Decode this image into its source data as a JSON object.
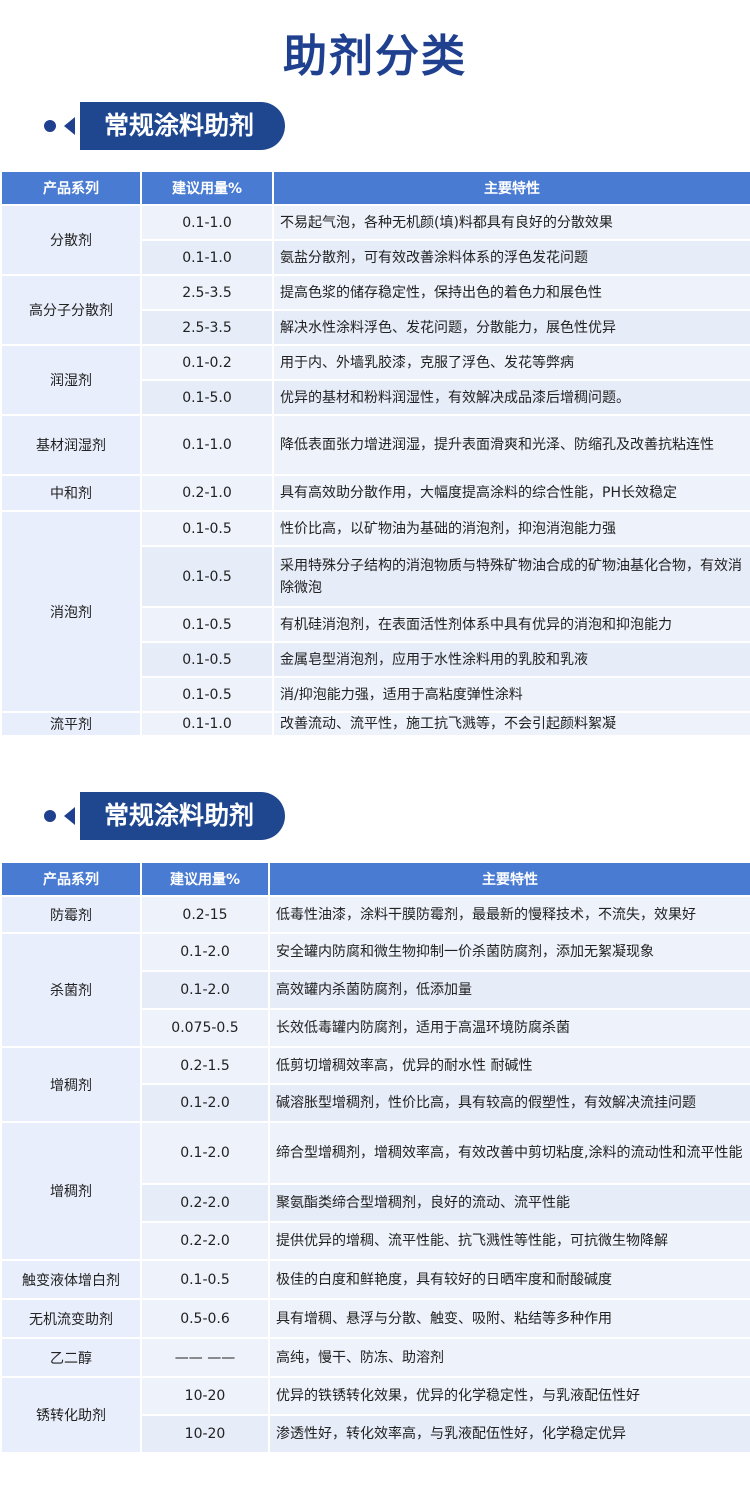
{
  "title": "助剂分类",
  "sections": [
    {
      "heading": "常规涂料助剂",
      "columns": [
        "产品系列",
        "建议用量%",
        "主要特性"
      ],
      "groups": [
        {
          "series": "分散剂",
          "rows": [
            {
              "dose": "0.1-1.0",
              "feature": "不易起气泡，各种无机颜(填)料都具有良好的分散效果"
            },
            {
              "dose": "0.1-1.0",
              "feature": "氨盐分散剂，可有效改善涂料体系的浮色发花问题"
            }
          ]
        },
        {
          "series": "高分子分散剂",
          "rows": [
            {
              "dose": "2.5-3.5",
              "feature": "提高色浆的储存稳定性，保持出色的着色力和展色性"
            },
            {
              "dose": "2.5-3.5",
              "feature": "解决水性涂料浮色、发花问题，分散能力，展色性优异"
            }
          ]
        },
        {
          "series": "润湿剂",
          "rows": [
            {
              "dose": "0.1-0.2",
              "feature": "用于内、外墙乳胶漆，克服了浮色、发花等弊病"
            },
            {
              "dose": "0.1-5.0",
              "feature": "优异的基材和粉料润湿性，有效解决成品漆后增稠问题。"
            }
          ]
        },
        {
          "series": "基材润湿剂",
          "rows": [
            {
              "dose": "0.1-1.0",
              "feature": "降低表面张力增进润湿，提升表面滑爽和光泽、防缩孔及改善抗粘连性"
            }
          ]
        },
        {
          "series": "中和剂",
          "rows": [
            {
              "dose": "0.2-1.0",
              "feature": "具有高效助分散作用，大幅度提高涂料的综合性能，PH长效稳定"
            }
          ]
        },
        {
          "series": "消泡剂",
          "rows": [
            {
              "dose": "0.1-0.5",
              "feature": "性价比高，以矿物油为基础的消泡剂，抑泡消泡能力强"
            },
            {
              "dose": "0.1-0.5",
              "feature": "采用特殊分子结构的消泡物质与特殊矿物油合成的矿物油基化合物，有效消除微泡"
            },
            {
              "dose": "0.1-0.5",
              "feature": "有机硅消泡剂，在表面活性剂体系中具有优异的消泡和抑泡能力"
            },
            {
              "dose": "0.1-0.5",
              "feature": "金属皂型消泡剂，应用于水性涂料用的乳胶和乳液"
            },
            {
              "dose": "0.1-0.5",
              "feature": "消/抑泡能力强，适用于高粘度弹性涂料"
            }
          ]
        },
        {
          "series": "流平剂",
          "rows": [
            {
              "dose": "0.1-1.0",
              "feature": "改善流动、流平性，施工抗飞溅等，不会引起颜料絮凝"
            }
          ]
        }
      ]
    },
    {
      "heading": "常规涂料助剂",
      "columns": [
        "产品系列",
        "建议用量%",
        "主要特性"
      ],
      "groups": [
        {
          "series": "防霉剂",
          "rows": [
            {
              "dose": "0.2-15",
              "feature": "低毒性油漆，涂料干膜防霉剂，最最新的慢释技术，不流失，效果好"
            }
          ]
        },
        {
          "series": "杀菌剂",
          "rows": [
            {
              "dose": "0.1-2.0",
              "feature": "安全罐内防腐和微生物抑制一价杀菌防腐剂，添加无絮凝现象"
            },
            {
              "dose": "0.1-2.0",
              "feature": "高效罐内杀菌防腐剂，低添加量"
            },
            {
              "dose": "0.075-0.5",
              "feature": "长效低毒罐内防腐剂，适用于高温环境防腐杀菌"
            }
          ]
        },
        {
          "series": "增稠剂",
          "rows": [
            {
              "dose": "0.2-1.5",
              "feature": "低剪切增稠效率高，优异的耐水性 耐碱性"
            },
            {
              "dose": "0.1-2.0",
              "feature": "碱溶胀型增稠剂，性价比高，具有较高的假塑性，有效解决流挂问题"
            }
          ]
        },
        {
          "series": "增稠剂",
          "rows": [
            {
              "dose": "0.1-2.0",
              "feature": "缔合型增稠剂，增稠效率高，有效改善中剪切粘度,涂料的流动性和流平性能"
            },
            {
              "dose": "0.2-2.0",
              "feature": "聚氨酯类缔合型增稠剂，良好的流动、流平性能"
            },
            {
              "dose": "0.2-2.0",
              "feature": "提供优异的增稠、流平性能、抗飞溅性等性能，可抗微生物降解"
            }
          ]
        },
        {
          "series": "触变液体增白剂",
          "rows": [
            {
              "dose": "0.1-0.5",
              "feature": "极佳的白度和鲜艳度，具有较好的日晒牢度和耐酸碱度"
            }
          ]
        },
        {
          "series": "无机流变助剂",
          "rows": [
            {
              "dose": "0.5-0.6",
              "feature": "具有增稠、悬浮与分散、触变、吸附、粘结等多种作用"
            }
          ]
        },
        {
          "series": "乙二醇",
          "rows": [
            {
              "dose": "—— ——",
              "feature": "高纯，慢干、防冻、助溶剂"
            }
          ]
        },
        {
          "series": "锈转化助剂",
          "rows": [
            {
              "dose": "10-20",
              "feature": "优异的铁锈转化效果，优异的化学稳定性，与乳液配伍性好"
            },
            {
              "dose": "10-20",
              "feature": "渗透性好，转化效率高，与乳液配伍性好，化学稳定优异"
            }
          ]
        }
      ]
    }
  ]
}
